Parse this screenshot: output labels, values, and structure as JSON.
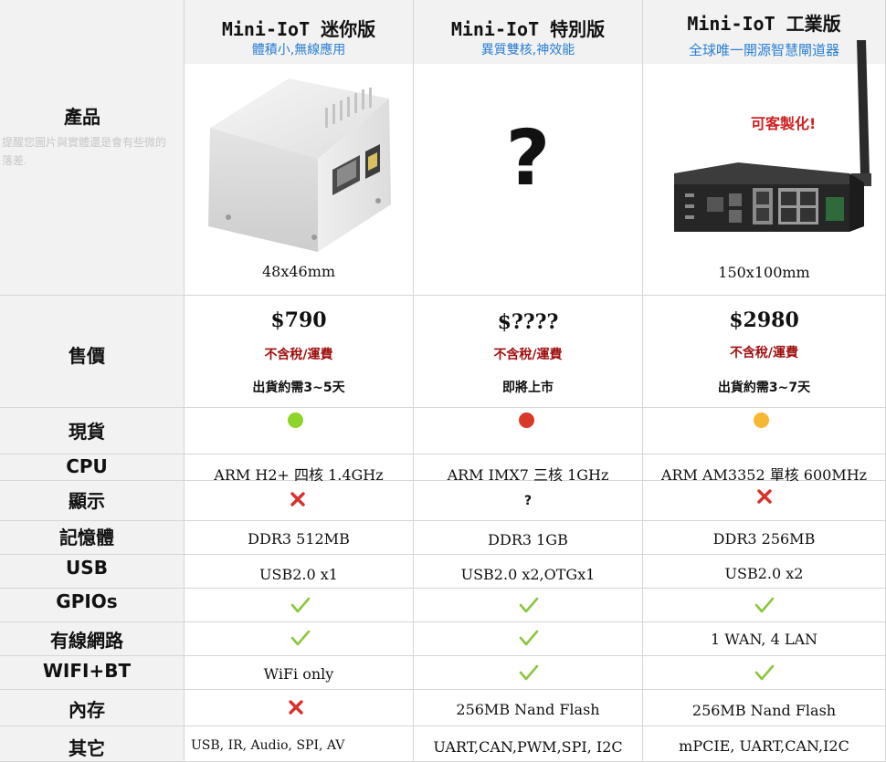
{
  "labels": {
    "product": "產品",
    "price": "售價",
    "stock": "現貨",
    "cpu": "CPU",
    "display": "顯示",
    "memory": "記憶體",
    "usb": "USB",
    "gpio": "GPIOs",
    "ethernet": "有線網路",
    "wifi": "WIFI+BT",
    "storage": "內存",
    "other": "其它"
  },
  "note": "提醒您圖片與實體還是會有些微的落差.",
  "products": [
    {
      "name": "Mini-IoT 迷你版",
      "subtitle": "體積小,無線應用",
      "size": "48x46mm",
      "price": "$790",
      "tax": "不含稅/運費",
      "ship": "出貨約需3~5天",
      "stock_color": "#8fd42b",
      "cpu": "ARM H2+ 四核 1.4GHz",
      "display": "cross-icon",
      "memory": "DDR3 512MB",
      "usb": "USB2.0 x1",
      "gpio": "check-icon",
      "ethernet": "check-icon",
      "wifi": "WiFi only",
      "storage": "cross-icon",
      "other": "USB, IR, Audio, SPI, AV"
    },
    {
      "name": "Mini-IoT 特別版",
      "subtitle": "異質雙核,神效能",
      "price": "$????",
      "tax": "不含稅/運費",
      "ship": "即將上市",
      "stock_color": "#d8392b",
      "cpu": "ARM IMX7 三核 1GHz",
      "display": "?",
      "memory": "DDR3 1GB",
      "usb": "USB2.0 x2,OTGx1",
      "gpio": "check-icon",
      "ethernet": "check-icon",
      "wifi": "check-icon",
      "storage": "256MB Nand Flash",
      "other": "UART,CAN,PWM,SPI, I2C",
      "image_placeholder": "?"
    },
    {
      "name": "Mini-IoT 工業版",
      "subtitle": "全球唯一開源智慧閘道器",
      "badge": "可客製化!",
      "size": "150x100mm",
      "price": "$2980",
      "tax": "不含稅/運費",
      "ship": "出貨約需3~7天",
      "stock_color": "#f7b733",
      "cpu": "ARM AM3352 單核 600MHz",
      "display": "cross-icon",
      "memory": "DDR3 256MB",
      "usb": "USB2.0 x2",
      "gpio": "check-icon",
      "ethernet": "1 WAN, 4 LAN",
      "wifi": "check-icon",
      "storage": "256MB Nand Flash",
      "other": "mPCIE, UART,CAN,I2C"
    }
  ],
  "colors": {
    "accent_blue": "#2a7fd4",
    "tax_red": "#a01010",
    "badge_red": "#d02020",
    "check_green": "#8cc63f",
    "cross_red": "#d9302c"
  }
}
